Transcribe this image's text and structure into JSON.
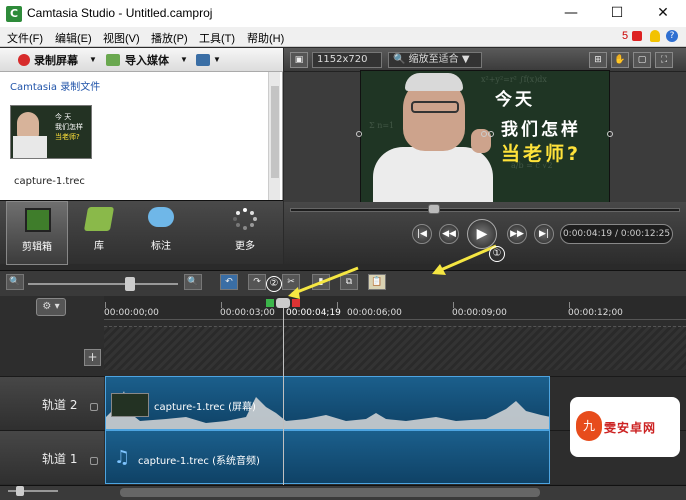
{
  "window": {
    "title": "Camtasia Studio - Untitled.camproj",
    "icon": "camtasia-logo-icon",
    "app_icon_letter": "C"
  },
  "menu": [
    "文件(F)",
    "编辑(E)",
    "视图(V)",
    "播放(P)",
    "工具(T)",
    "帮助(H)"
  ],
  "menu_right": {
    "notification_count": "5"
  },
  "left_toolbar": {
    "record_label": "录制屏幕",
    "import_label": "导入媒体"
  },
  "clip_bin": {
    "title": "Camtasia 录制文件",
    "clip_name": "capture-1.trec",
    "thumb_text": "今天\n我们怎样\n当老师?"
  },
  "tabs": [
    {
      "label": "剪辑箱",
      "icon": "film-strip-icon",
      "active": true
    },
    {
      "label": "库",
      "icon": "library-folder-icon",
      "active": false
    },
    {
      "label": "标注",
      "icon": "speech-bubble-icon",
      "active": false
    },
    {
      "label": "更多",
      "icon": "more-dots-icon",
      "active": false
    }
  ],
  "preview": {
    "resolution": "1152x720",
    "zoom": "缩放至适合",
    "video_line1": "今天",
    "video_line2": "我们怎样",
    "video_line3": "当老师?",
    "time": "0:00:04:19 / 0:00:12:25",
    "seek_fraction": 0.37
  },
  "timeline": {
    "ticks": [
      "00:00:00;00",
      "00:00:03;00",
      "00:00:06;00",
      "00:00:09;00",
      "00:00:12;00"
    ],
    "playhead_label": "00:00:04;19",
    "tracks": [
      {
        "name": "轨道 2",
        "clip_label": "capture-1.trec (屏幕)"
      },
      {
        "name": "轨道 1",
        "clip_label": "capture-1.trec (系统音频)"
      }
    ]
  },
  "annotations": {
    "marker1": "①",
    "marker2": "②"
  },
  "watermark": {
    "text": "雯安卓网",
    "logo_letter": "九"
  },
  "colors": {
    "accent_green": "#3bb54a",
    "annotation_yellow": "#f5e642",
    "clip_blue": "#1b5f8c",
    "video_text_yellow": "#ffe23a"
  }
}
